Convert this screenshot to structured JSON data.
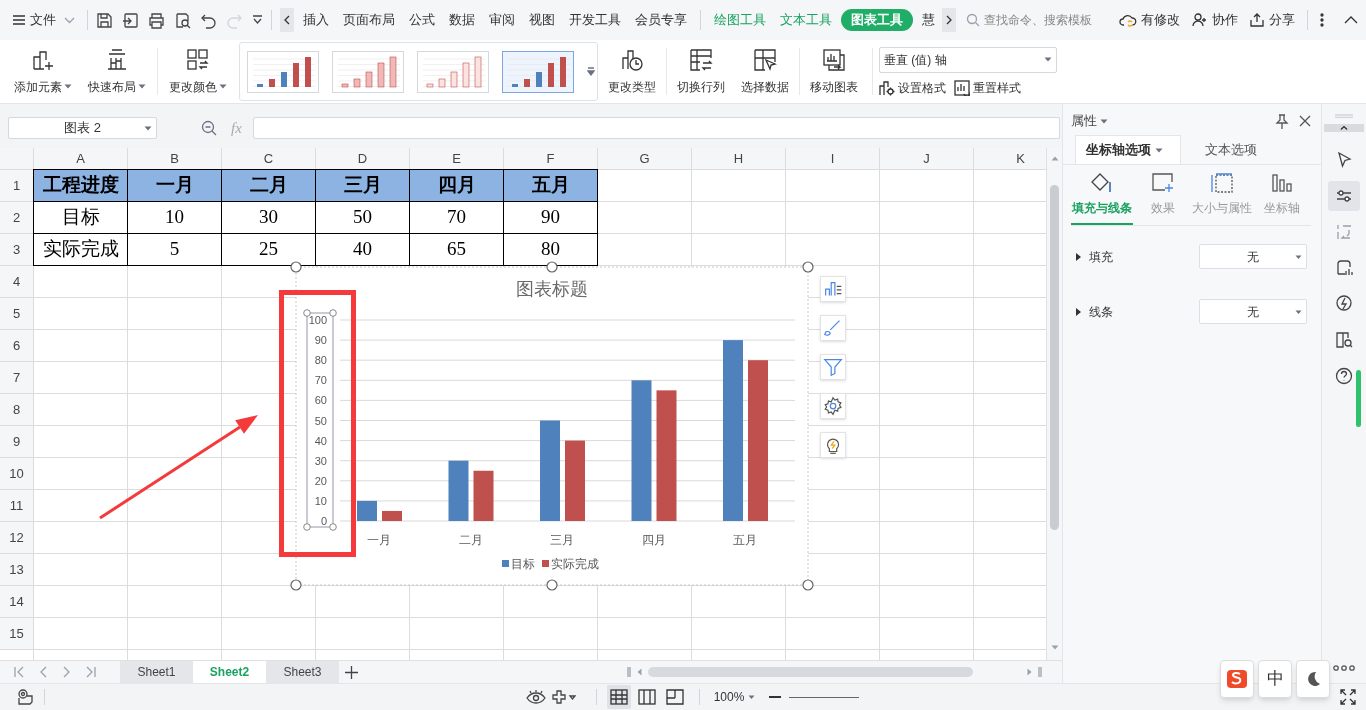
{
  "title_bar": {
    "file_menu": "文件",
    "tabs": [
      {
        "label": "插入",
        "kind": "plain",
        "selected": false
      },
      {
        "label": "页面布局",
        "kind": "plain",
        "selected": false
      },
      {
        "label": "公式",
        "kind": "plain",
        "selected": false
      },
      {
        "label": "数据",
        "kind": "plain",
        "selected": false
      },
      {
        "label": "审阅",
        "kind": "plain",
        "selected": false
      },
      {
        "label": "视图",
        "kind": "plain",
        "selected": false
      },
      {
        "label": "开发工具",
        "kind": "plain",
        "selected": false
      },
      {
        "label": "会员专享",
        "kind": "plain",
        "selected": false
      },
      {
        "label": "绘图工具",
        "kind": "context",
        "selected": false
      },
      {
        "label": "文本工具",
        "kind": "context",
        "selected": false
      },
      {
        "label": "图表工具",
        "kind": "context",
        "selected": true
      },
      {
        "label": "慧",
        "kind": "plain",
        "selected": false
      }
    ],
    "search": {
      "placeholder": "查找命令、搜索模板"
    },
    "actions": [
      {
        "label": "有修改",
        "kind": "cloud"
      },
      {
        "label": "协作",
        "kind": "collab"
      },
      {
        "label": "分享",
        "kind": "share"
      }
    ]
  },
  "ribbon": {
    "buttons_left": [
      {
        "label": "添加元素",
        "kind": "add-element",
        "dropdown": true
      },
      {
        "label": "快速布局",
        "kind": "layout",
        "dropdown": true
      },
      {
        "label": "更改颜色",
        "kind": "color",
        "dropdown": true
      }
    ],
    "styles": [
      {
        "kind": "solid",
        "selected": false
      },
      {
        "kind": "pattern",
        "selected": false
      },
      {
        "kind": "outline",
        "selected": false
      },
      {
        "kind": "solid",
        "selected": true
      }
    ],
    "buttons_right": [
      {
        "label": "更改类型",
        "kind": "change-type"
      },
      {
        "label": "切换行列",
        "kind": "switch"
      },
      {
        "label": "选择数据",
        "kind": "select-data"
      },
      {
        "label": "移动图表",
        "kind": "move"
      }
    ],
    "element_select": "垂直 (值) 轴",
    "format_buttons": [
      {
        "label": "设置格式",
        "kind": "format"
      },
      {
        "label": "重置样式",
        "kind": "reset"
      }
    ]
  },
  "formula_bar": {
    "name_box": "图表 2",
    "fx": "fx"
  },
  "sheet": {
    "columns": [
      "A",
      "B",
      "C",
      "D",
      "E",
      "F",
      "G",
      "H",
      "I",
      "J",
      "K"
    ],
    "row_numbers": [
      "1",
      "2",
      "3",
      "4",
      "5",
      "6",
      "7",
      "8",
      "9",
      "10",
      "11",
      "12",
      "13",
      "14",
      "15"
    ],
    "header": [
      "工程进度",
      "一月",
      "二月",
      "三月",
      "四月",
      "五月"
    ],
    "rows": [
      [
        "目标",
        "10",
        "30",
        "50",
        "70",
        "90"
      ],
      [
        "实际完成",
        "5",
        "25",
        "40",
        "65",
        "80"
      ]
    ]
  },
  "chart": {
    "selected": true,
    "axis_selected": true,
    "chart_data": {
      "type": "bar",
      "title": "图表标题",
      "categories": [
        "一月",
        "二月",
        "三月",
        "四月",
        "五月"
      ],
      "series": [
        {
          "name": "目标",
          "color": "#4f81bd",
          "values": [
            10,
            30,
            50,
            70,
            90
          ]
        },
        {
          "name": "实际完成",
          "color": "#c0504d",
          "values": [
            5,
            25,
            40,
            65,
            80
          ]
        }
      ],
      "grid": true,
      "legend": true,
      "ylim": [
        0,
        100
      ],
      "yticks": [
        {
          "value": 0,
          "label": "0"
        },
        {
          "value": 10,
          "label": "10"
        },
        {
          "value": 20,
          "label": "20"
        },
        {
          "value": 30,
          "label": "30"
        },
        {
          "value": 40,
          "label": "40"
        },
        {
          "value": 50,
          "label": "50"
        },
        {
          "value": 60,
          "label": "60"
        },
        {
          "value": 70,
          "label": "70"
        },
        {
          "value": 80,
          "label": "80"
        },
        {
          "value": 90,
          "label": "90"
        },
        {
          "value": 100,
          "label": "100"
        }
      ]
    }
  },
  "sheet_tabs": [
    {
      "label": "Sheet1",
      "selected": false
    },
    {
      "label": "Sheet2",
      "selected": true
    },
    {
      "label": "Sheet3",
      "selected": false
    }
  ],
  "properties_panel": {
    "title": "属性",
    "tabs": [
      {
        "label": "坐标轴选项",
        "selected": true,
        "dropdown": true
      },
      {
        "label": "文本选项",
        "selected": false,
        "dropdown": false
      }
    ],
    "subtabs": [
      {
        "label": "填充与线条",
        "kind": "fill",
        "selected": true
      },
      {
        "label": "效果",
        "kind": "effect",
        "selected": false
      },
      {
        "label": "大小与属性",
        "kind": "size",
        "selected": false
      },
      {
        "label": "坐标轴",
        "kind": "axis",
        "selected": false
      }
    ],
    "sections": [
      {
        "label": "填充",
        "value": "无",
        "expanded": false
      },
      {
        "label": "线条",
        "value": "无",
        "expanded": false
      }
    ]
  },
  "side_toolbar": [
    {
      "kind": "select",
      "selected": false
    },
    {
      "kind": "properties",
      "selected": true
    },
    {
      "kind": "swap",
      "selected": false
    },
    {
      "kind": "style",
      "selected": false
    },
    {
      "kind": "ideas",
      "selected": false
    },
    {
      "kind": "book",
      "selected": false
    },
    {
      "kind": "help",
      "selected": false
    }
  ],
  "status_bar": {
    "views": [
      {
        "kind": "normal",
        "selected": true
      },
      {
        "kind": "page",
        "selected": false
      },
      {
        "kind": "break",
        "selected": false
      }
    ],
    "zoom": "100%"
  },
  "ime": {
    "label": "中"
  }
}
